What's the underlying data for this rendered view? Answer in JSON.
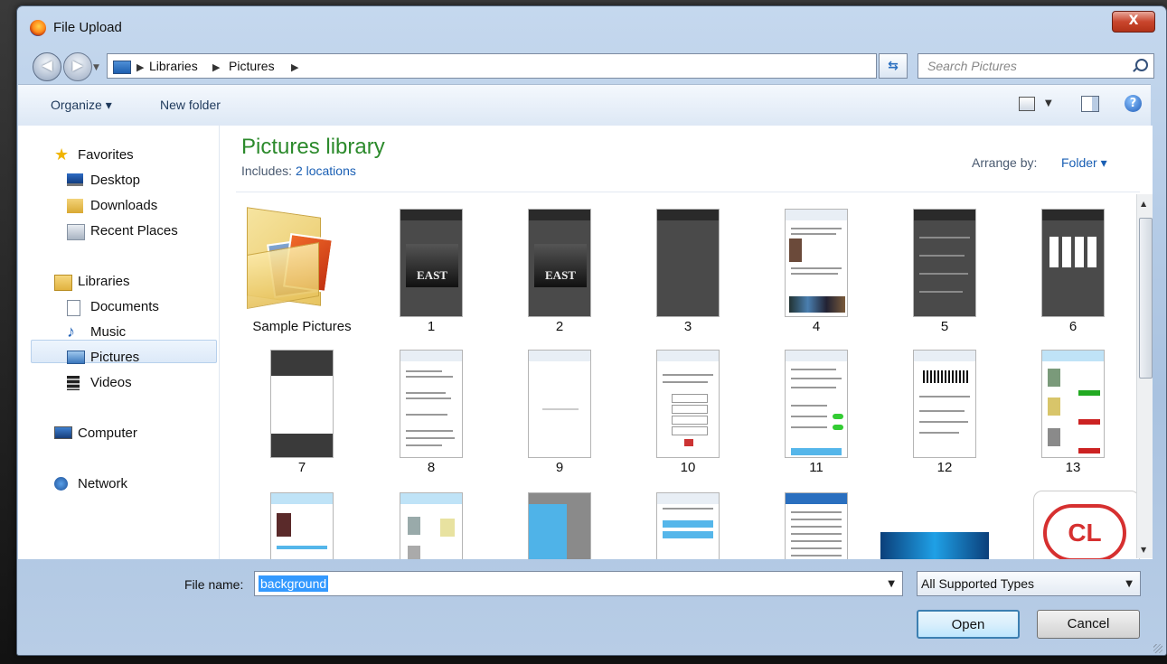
{
  "window": {
    "title": "File Upload",
    "close_label": "X"
  },
  "nav": {
    "back_glyph": "◀",
    "forward_glyph": "▶",
    "breadcrumb": [
      "Libraries",
      "Pictures"
    ],
    "search_placeholder": "Search Pictures"
  },
  "toolbar": {
    "organize": "Organize ▾",
    "new_folder": "New folder"
  },
  "sidebar": {
    "favorites": "Favorites",
    "desktop": "Desktop",
    "downloads": "Downloads",
    "recent_places": "Recent Places",
    "libraries": "Libraries",
    "documents": "Documents",
    "music": "Music",
    "pictures": "Pictures",
    "videos": "Videos",
    "computer": "Computer",
    "network": "Network"
  },
  "content": {
    "title": "Pictures library",
    "includes_label": "Includes:",
    "includes_link": "2 locations",
    "arrange_label": "Arrange by:",
    "arrange_value": "Folder ▾",
    "items": [
      "Sample Pictures",
      "1",
      "2",
      "3",
      "4",
      "5",
      "6",
      "7",
      "8",
      "9",
      "10",
      "11",
      "12",
      "13"
    ]
  },
  "bottom": {
    "filename_label": "File name:",
    "filename_value": "background",
    "filetype": "All Supported Types",
    "open": "Open",
    "cancel": "Cancel"
  },
  "colors": {
    "library_title": "#2c8a2c",
    "link": "#1a5fb4",
    "selection": "#3399ff"
  }
}
